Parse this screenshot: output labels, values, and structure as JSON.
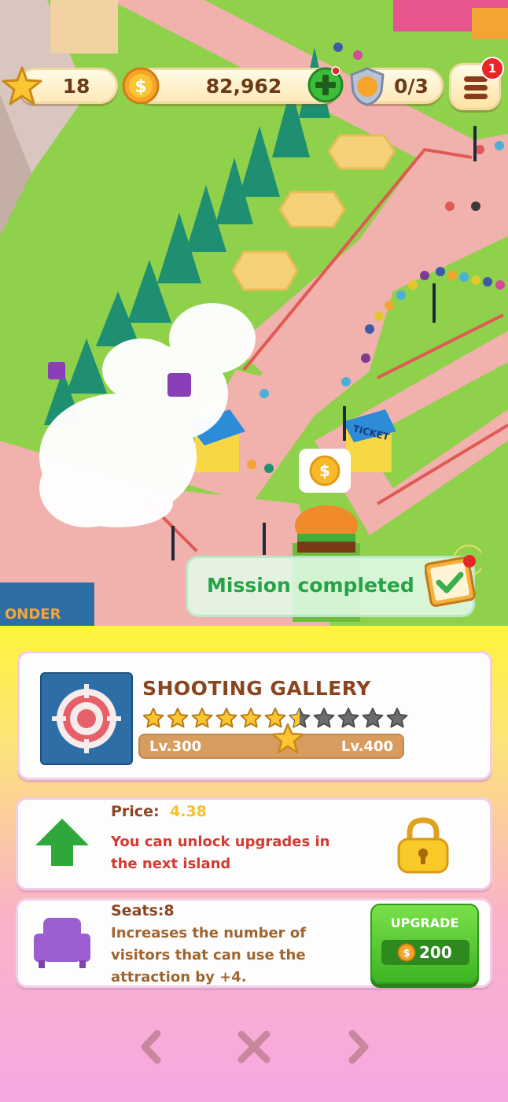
{
  "hud": {
    "stars": "18",
    "coins": "82,962",
    "gems": "0/3",
    "menu_badge": "1"
  },
  "toast": {
    "text": "Mission completed"
  },
  "scene": {
    "ticket_sign": "TICKET",
    "wonder_sign": "ONDER"
  },
  "attraction": {
    "name": "SHOOTING GALLERY",
    "stars_filled": 6.5,
    "stars_total": 11,
    "level_start": "Lv.300",
    "level_end": "Lv.400",
    "icon": "target-icon"
  },
  "price": {
    "label": "Price:",
    "value": "4.38",
    "note": "You can unlock upgrades in the next island",
    "icon": "arrow-up-icon"
  },
  "seats": {
    "label": "Seats:8",
    "description": "Increases the number of visitors that can use the attraction by +4.",
    "icon": "armchair-icon",
    "button_label": "UPGRADE",
    "cost": "200"
  },
  "colors": {
    "name_brown": "#8a4520",
    "warning_red": "#d33b32",
    "price_gold": "#fbc022",
    "upgrade_green": "#3cb522",
    "icon_purple": "#9b5fd0"
  }
}
